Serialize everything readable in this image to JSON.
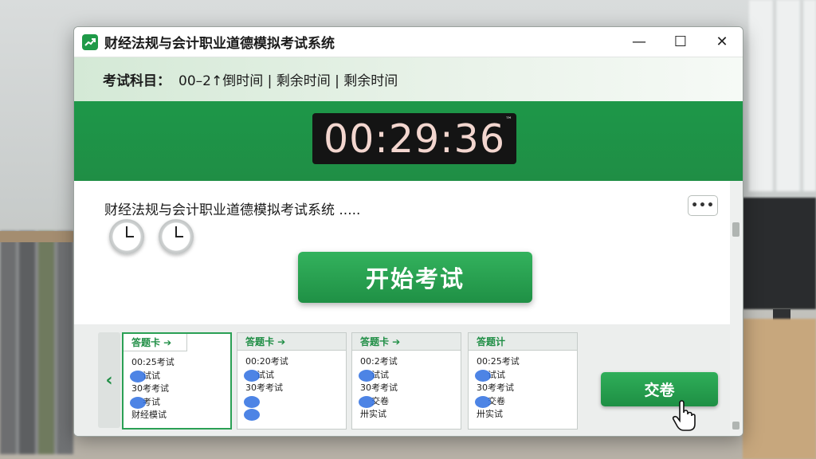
{
  "window": {
    "title": "财经法规与会计职业道德模拟考试系统",
    "minimize_symbol": "—",
    "maximize_symbol": "☐",
    "close_symbol": "✕"
  },
  "subject": {
    "label": "考试科目：",
    "value": "00–2↑倒时间 | 剩余时间 | 剩余时间"
  },
  "timer": {
    "value": "00:29:36",
    "mark": "™"
  },
  "content": {
    "title": "财经法规与会计职业道德模拟考试系统 .....",
    "more_label": "•••",
    "start_button": "开始考试"
  },
  "nav": {
    "prev_symbol": "‹"
  },
  "cards": [
    {
      "tab": "答题卡 ➔",
      "lines": [
        "00:25考试",
        "试试",
        "30考考试",
        "考试",
        "财经模试"
      ]
    },
    {
      "tab": "答题卡 ➔",
      "lines": [
        "00:20考试",
        "试试",
        "30考考试",
        "",
        ""
      ]
    },
    {
      "tab": "答题卡 ➔",
      "lines": [
        "00:2考试",
        "试试",
        "30考考试",
        "交卷",
        "卅实试"
      ]
    },
    {
      "tab": "答题计",
      "lines": [
        "00:25考试",
        "试试",
        "30考考试",
        "交卷",
        "卅实试"
      ]
    }
  ],
  "submit_button": "交卷",
  "colors": {
    "brand_green": "#1f9045",
    "timer_bg": "#141414",
    "timer_text": "#f3d6cf",
    "mark_blue": "#2e6fe0"
  }
}
